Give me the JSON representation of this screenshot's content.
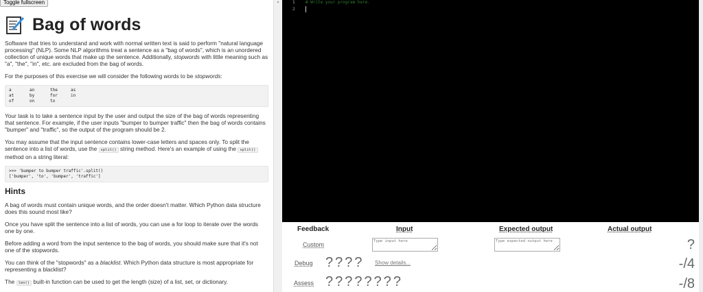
{
  "toggle_label": "Toggle fullscreen",
  "title": "Bag of words",
  "intro": [
    "Software that tries to understand and work with normal written text is said to perform \"natural language processing\" (NLP). Some NLP algorithms treat a sentence as a \"bag of words\", which is an unordered collection of unique words that make up the sentence. Additionally, ",
    "stopwords",
    " with little meaning such as \"a\", \"the\", \"in\", etc. are excluded from the bag of words."
  ],
  "purpose": [
    "For the purposes of this exercise we will consider the following words to be ",
    "stopwords",
    ":"
  ],
  "stopwords": [
    "a",
    "an",
    "the",
    "as",
    "at",
    "by",
    "for",
    "in",
    "of",
    "on",
    "to"
  ],
  "task": "Your task is to take a sentence input by the user and output the size of the bag of words representing that sentence. For example, if the user inputs \"bumper to bumper traffic\" then the bag of words contains \"bumper\" and \"traffic\", so the output of the program should be 2.",
  "assume": [
    "You may assume that the input sentence contains lower-case letters and spaces only. To split the sentence into a list of words, use the ",
    "split()",
    " string method. Here's an example of using the ",
    "split()",
    " method on a string literal:"
  ],
  "example": ">>> 'bumper to bumper traffic'.split()\n['bumper', 'to', 'bumper', 'traffic']",
  "hints_title": "Hints",
  "hints": [
    "A bag of words must contain unique words, and the order doesn't matter. Which Python data structure does this sound most like?",
    "Once you have split the sentence into a list of words, you can use a for loop to iterate over the words one by one.",
    "Before adding a word from the input sentence to the bag of words, you should make sure that it's not one of the stopwords."
  ],
  "hint4": [
    "You can think of the \"stopwords\" as a ",
    "blacklist",
    ". Which Python data structure is most appropriate for representing a blacklist?"
  ],
  "hint5": [
    "The ",
    "len()",
    " built-in function can be used to get the length (size) of a list, set, or dictionary."
  ],
  "editor": {
    "lines": [
      "1",
      "2"
    ],
    "code": "# Write your program here."
  },
  "feedback": {
    "headers": [
      "Feedback",
      "Input",
      "Expected output",
      "Actual output"
    ],
    "custom": "Custom",
    "input_placeholder": "Type input here",
    "expected_placeholder": "Type expected output here",
    "custom_result": "?",
    "debug": "Debug",
    "debug_marks": "????",
    "show_details": "Show details...",
    "debug_score": "-/4",
    "assess": "Assess",
    "assess_marks": "????????",
    "assess_score": "-/8"
  }
}
